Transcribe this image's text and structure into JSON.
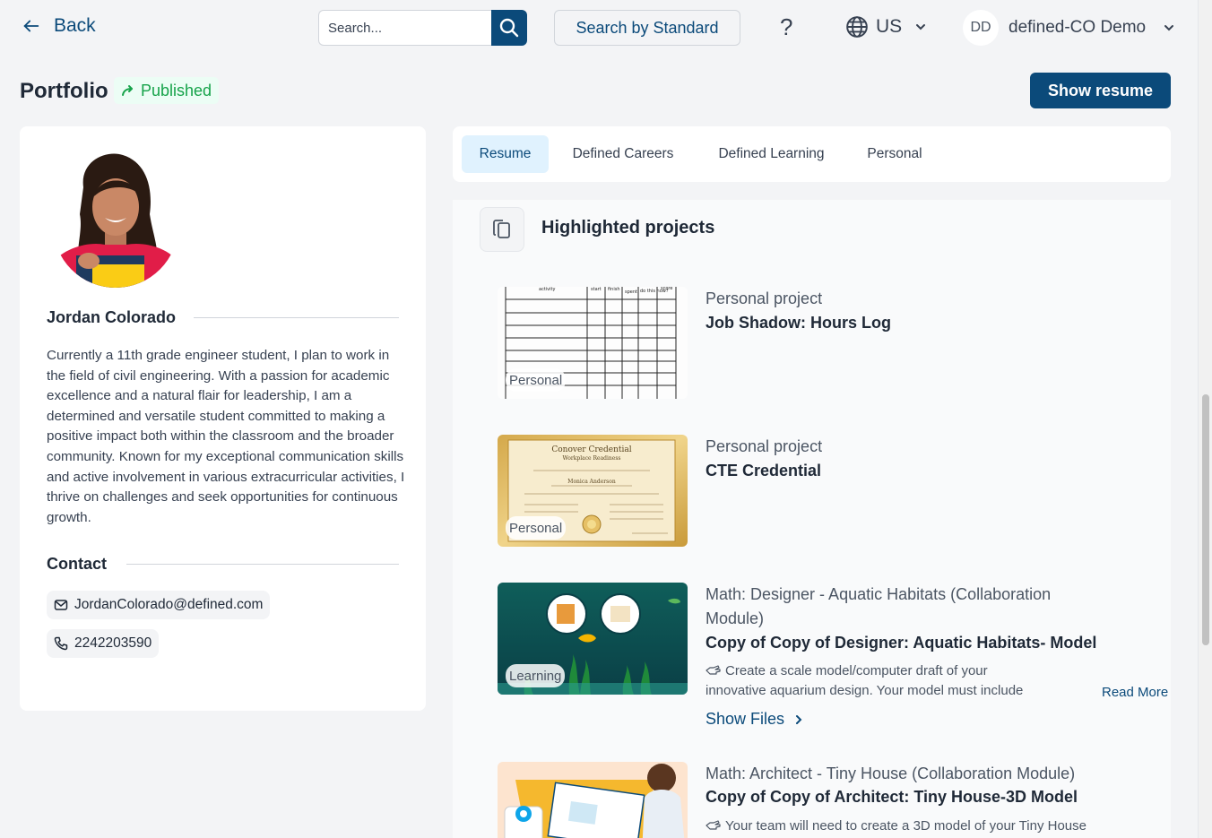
{
  "header": {
    "back_label": "Back",
    "search_placeholder": "Search...",
    "search_by_standard_label": "Search by Standard",
    "help_label": "?",
    "locale_label": "US",
    "user_initials": "DD",
    "user_name": "defined-CO Demo"
  },
  "page": {
    "title": "Portfolio",
    "status": "Published",
    "show_resume_label": "Show resume"
  },
  "profile": {
    "name": "Jordan Colorado",
    "bio": "Currently a 11th grade engineer student, I plan to work in the field of civil engineering. With a passion for academic excellence and a natural flair for leadership, I am a determined and versatile student committed to making a positive impact both within the classroom and the broader community. Known for my exceptional communication skills and active involvement in various extracurricular activities, I thrive on challenges and seek opportunities for continuous growth.",
    "contact_label": "Contact",
    "email": "JordanColorado@defined.com",
    "phone": "2242203590"
  },
  "tabs": [
    {
      "label": "Resume",
      "active": true
    },
    {
      "label": "Defined Careers",
      "active": false
    },
    {
      "label": "Defined Learning",
      "active": false
    },
    {
      "label": "Personal",
      "active": false
    }
  ],
  "highlighted": {
    "title": "Highlighted projects",
    "projects": [
      {
        "badge": "Personal",
        "category": "Personal project",
        "title": "Job Shadow: Hours Log",
        "log_headers": [
          "activity",
          "start",
          "finish",
          "spent",
          "do this now?",
          "score"
        ]
      },
      {
        "badge": "Personal",
        "category": "Personal project",
        "title": "CTE Credential",
        "cert_heading": "Conover Credential",
        "cert_sub": "Workplace Readiness",
        "cert_name": "Monica Anderson"
      },
      {
        "badge": "Learning",
        "category": "Math: Designer - Aquatic Habitats (Collaboration Module)",
        "title": "Copy of Copy of Designer: Aquatic Habitats- Model",
        "description": "Create a scale model/computer draft of your innovative aquarium design. Your model must include both the",
        "read_more": "Read More",
        "show_files": "Show Files"
      },
      {
        "badge": "",
        "category": "Math: Architect - Tiny House (Collaboration Module)",
        "title": "Copy of Copy of Architect: Tiny House-3D Model",
        "description": "Your team will need to create a 3D model of your Tiny House"
      }
    ]
  },
  "colors": {
    "brand": "#0b4a7a",
    "published": "#16a34a",
    "background": "#f3f4f6"
  }
}
